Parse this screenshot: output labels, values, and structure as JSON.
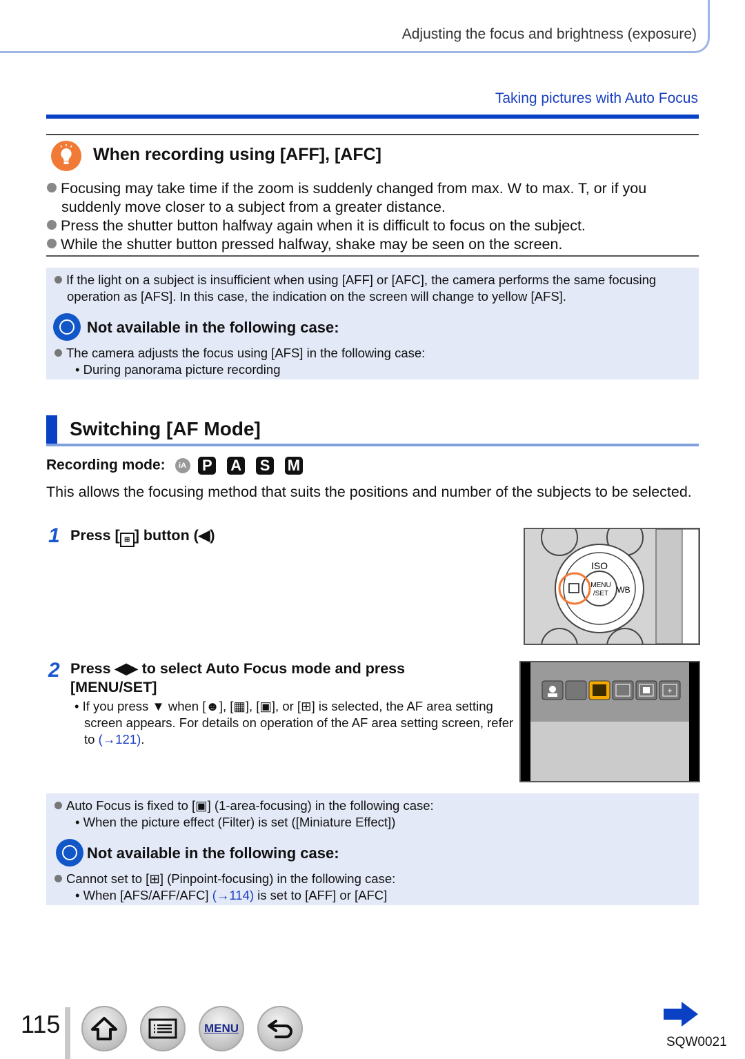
{
  "header": {
    "chapter_title": "Adjusting the focus and brightness (exposure)",
    "section_link": "Taking pictures with Auto Focus"
  },
  "tip": {
    "title": "When recording using [AFF], [AFC]",
    "items": [
      "Focusing may take time if the zoom is suddenly changed from max. W to max. T, or if you suddenly move closer to a subject from a greater distance.",
      "Press the shutter button halfway again when it is difficult to focus on the subject.",
      "While the shutter button pressed halfway, shake may be seen on the screen."
    ]
  },
  "note1": {
    "text": "If the light on a subject is insufficient when using [AFF] or [AFC], the camera performs the same focusing operation as [AFS]. In this case, the indication on the screen will change to yellow [AFS].",
    "na_title": "Not available in the following case:",
    "na_item": "The camera adjusts the focus using [AFS] in the following case:",
    "na_sub": "During panorama picture recording"
  },
  "section": {
    "title": "Switching [AF Mode]",
    "recording_mode_label": "Recording mode:",
    "modes": [
      "iA",
      "P",
      "A",
      "S",
      "M"
    ],
    "intro": "This allows the focusing method that suits the positions and number of the subjects to be selected."
  },
  "steps": [
    {
      "num": "1",
      "pre": "Press [",
      "post": "] button (◀)"
    },
    {
      "num": "2",
      "text": "Press ◀▶ to select Auto Focus mode and press [MENU/SET]",
      "note_pre": "If you press ▼ when [",
      "note_mid1": "], [",
      "note_mid2": "], [",
      "note_mid3": "], or [",
      "note_post": "] is selected, the AF area setting screen appears. For details on operation of the AF area setting screen, refer to ",
      "note_link": "(→121)",
      "note_end": "."
    }
  ],
  "dial": {
    "iso": "ISO",
    "menu": "MENU",
    "set": "/SET",
    "wb": "WB"
  },
  "note2": {
    "pre": "Auto Focus is fixed to [",
    "post": "] (1-area-focusing) in the following case:",
    "sub": "When the picture effect (Filter) is set ([Miniature Effect])",
    "na_title": "Not available in the following case:",
    "na_pre": "Cannot set to [",
    "na_post": "] (Pinpoint-focusing) in the following case:",
    "na_sub_pre": "When [AFS/AFF/AFC] ",
    "na_sub_link": "(→114)",
    "na_sub_post": " is set to [AFF] or [AFC]"
  },
  "footer": {
    "page_number": "115",
    "menu_label": "MENU",
    "doc_code": "SQW0021"
  },
  "colors": {
    "accent": "#0a40c4",
    "link": "#1a3fbf",
    "note_bg": "#e3e9f7",
    "tip_icon": "#f07a36",
    "selected_af": "#f5a800"
  }
}
